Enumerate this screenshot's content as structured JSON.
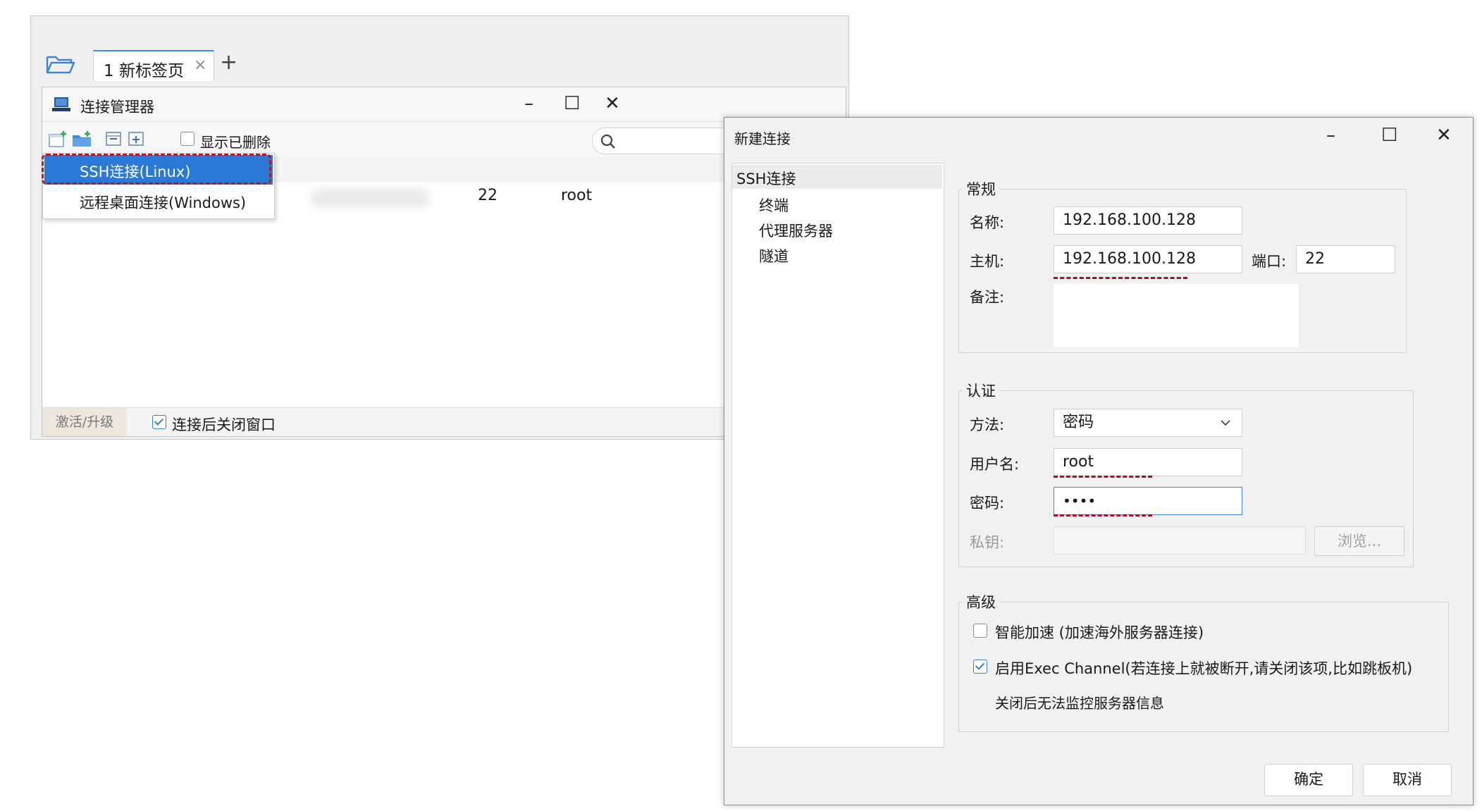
{
  "app": {
    "tabs": [
      {
        "label": "1 新标签页",
        "close": "×"
      }
    ],
    "add_tab": "+"
  },
  "conn_manager": {
    "title": "连接管理器",
    "minimize": "–",
    "maximize": "☐",
    "close": "✕",
    "show_deleted": "显示已删除",
    "rows": [
      {
        "port": "22",
        "user": "root"
      }
    ],
    "activate": "激活/升级",
    "close_after_connect": "连接后关闭窗口"
  },
  "new_menu": {
    "items": [
      "SSH连接(Linux)",
      "远程桌面连接(Windows)"
    ]
  },
  "dialog": {
    "title": "新建连接",
    "nav": {
      "root": "SSH连接",
      "children": [
        "终端",
        "代理服务器",
        "隧道"
      ]
    },
    "general": {
      "legend": "常规",
      "name_label": "名称:",
      "name_value": "192.168.100.128",
      "host_label": "主机:",
      "host_value": "192.168.100.128",
      "port_label": "端口:",
      "port_value": "22",
      "note_label": "备注:"
    },
    "auth": {
      "legend": "认证",
      "method_label": "方法:",
      "method_value": "密码",
      "user_label": "用户名:",
      "user_value": "root",
      "password_label": "密码:",
      "password_value": "••••",
      "key_label": "私钥:",
      "browse": "浏览..."
    },
    "advanced": {
      "legend": "高级",
      "smart_accel": "智能加速 (加速海外服务器连接)",
      "exec_channel": "启用Exec Channel(若连接上就被断开,请关闭该项,比如跳板机)",
      "exec_note": "关闭后无法监控服务器信息"
    },
    "ok": "确定",
    "cancel": "取消"
  },
  "colors": {
    "accent": "#2b79d6",
    "highlight_dash": "#b3172b"
  }
}
